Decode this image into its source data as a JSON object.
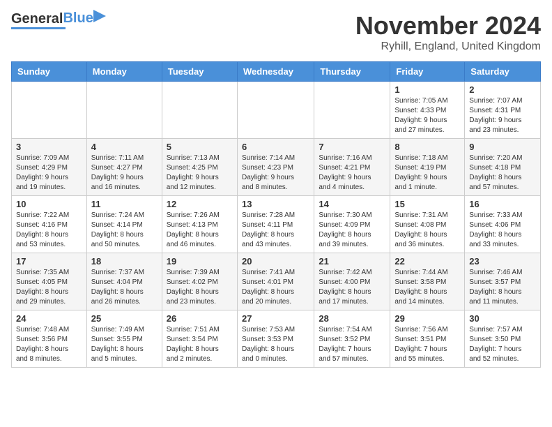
{
  "header": {
    "logo_general": "General",
    "logo_blue": "Blue",
    "title": "November 2024",
    "subtitle": "Ryhill, England, United Kingdom"
  },
  "days_of_week": [
    "Sunday",
    "Monday",
    "Tuesday",
    "Wednesday",
    "Thursday",
    "Friday",
    "Saturday"
  ],
  "weeks": [
    {
      "days": [
        {
          "date": "",
          "info": ""
        },
        {
          "date": "",
          "info": ""
        },
        {
          "date": "",
          "info": ""
        },
        {
          "date": "",
          "info": ""
        },
        {
          "date": "",
          "info": ""
        },
        {
          "date": "1",
          "info": "Sunrise: 7:05 AM\nSunset: 4:33 PM\nDaylight: 9 hours\nand 27 minutes."
        },
        {
          "date": "2",
          "info": "Sunrise: 7:07 AM\nSunset: 4:31 PM\nDaylight: 9 hours\nand 23 minutes."
        }
      ]
    },
    {
      "days": [
        {
          "date": "3",
          "info": "Sunrise: 7:09 AM\nSunset: 4:29 PM\nDaylight: 9 hours\nand 19 minutes."
        },
        {
          "date": "4",
          "info": "Sunrise: 7:11 AM\nSunset: 4:27 PM\nDaylight: 9 hours\nand 16 minutes."
        },
        {
          "date": "5",
          "info": "Sunrise: 7:13 AM\nSunset: 4:25 PM\nDaylight: 9 hours\nand 12 minutes."
        },
        {
          "date": "6",
          "info": "Sunrise: 7:14 AM\nSunset: 4:23 PM\nDaylight: 9 hours\nand 8 minutes."
        },
        {
          "date": "7",
          "info": "Sunrise: 7:16 AM\nSunset: 4:21 PM\nDaylight: 9 hours\nand 4 minutes."
        },
        {
          "date": "8",
          "info": "Sunrise: 7:18 AM\nSunset: 4:19 PM\nDaylight: 9 hours\nand 1 minute."
        },
        {
          "date": "9",
          "info": "Sunrise: 7:20 AM\nSunset: 4:18 PM\nDaylight: 8 hours\nand 57 minutes."
        }
      ]
    },
    {
      "days": [
        {
          "date": "10",
          "info": "Sunrise: 7:22 AM\nSunset: 4:16 PM\nDaylight: 8 hours\nand 53 minutes."
        },
        {
          "date": "11",
          "info": "Sunrise: 7:24 AM\nSunset: 4:14 PM\nDaylight: 8 hours\nand 50 minutes."
        },
        {
          "date": "12",
          "info": "Sunrise: 7:26 AM\nSunset: 4:13 PM\nDaylight: 8 hours\nand 46 minutes."
        },
        {
          "date": "13",
          "info": "Sunrise: 7:28 AM\nSunset: 4:11 PM\nDaylight: 8 hours\nand 43 minutes."
        },
        {
          "date": "14",
          "info": "Sunrise: 7:30 AM\nSunset: 4:09 PM\nDaylight: 8 hours\nand 39 minutes."
        },
        {
          "date": "15",
          "info": "Sunrise: 7:31 AM\nSunset: 4:08 PM\nDaylight: 8 hours\nand 36 minutes."
        },
        {
          "date": "16",
          "info": "Sunrise: 7:33 AM\nSunset: 4:06 PM\nDaylight: 8 hours\nand 33 minutes."
        }
      ]
    },
    {
      "days": [
        {
          "date": "17",
          "info": "Sunrise: 7:35 AM\nSunset: 4:05 PM\nDaylight: 8 hours\nand 29 minutes."
        },
        {
          "date": "18",
          "info": "Sunrise: 7:37 AM\nSunset: 4:04 PM\nDaylight: 8 hours\nand 26 minutes."
        },
        {
          "date": "19",
          "info": "Sunrise: 7:39 AM\nSunset: 4:02 PM\nDaylight: 8 hours\nand 23 minutes."
        },
        {
          "date": "20",
          "info": "Sunrise: 7:41 AM\nSunset: 4:01 PM\nDaylight: 8 hours\nand 20 minutes."
        },
        {
          "date": "21",
          "info": "Sunrise: 7:42 AM\nSunset: 4:00 PM\nDaylight: 8 hours\nand 17 minutes."
        },
        {
          "date": "22",
          "info": "Sunrise: 7:44 AM\nSunset: 3:58 PM\nDaylight: 8 hours\nand 14 minutes."
        },
        {
          "date": "23",
          "info": "Sunrise: 7:46 AM\nSunset: 3:57 PM\nDaylight: 8 hours\nand 11 minutes."
        }
      ]
    },
    {
      "days": [
        {
          "date": "24",
          "info": "Sunrise: 7:48 AM\nSunset: 3:56 PM\nDaylight: 8 hours\nand 8 minutes."
        },
        {
          "date": "25",
          "info": "Sunrise: 7:49 AM\nSunset: 3:55 PM\nDaylight: 8 hours\nand 5 minutes."
        },
        {
          "date": "26",
          "info": "Sunrise: 7:51 AM\nSunset: 3:54 PM\nDaylight: 8 hours\nand 2 minutes."
        },
        {
          "date": "27",
          "info": "Sunrise: 7:53 AM\nSunset: 3:53 PM\nDaylight: 8 hours\nand 0 minutes."
        },
        {
          "date": "28",
          "info": "Sunrise: 7:54 AM\nSunset: 3:52 PM\nDaylight: 7 hours\nand 57 minutes."
        },
        {
          "date": "29",
          "info": "Sunrise: 7:56 AM\nSunset: 3:51 PM\nDaylight: 7 hours\nand 55 minutes."
        },
        {
          "date": "30",
          "info": "Sunrise: 7:57 AM\nSunset: 3:50 PM\nDaylight: 7 hours\nand 52 minutes."
        }
      ]
    }
  ]
}
